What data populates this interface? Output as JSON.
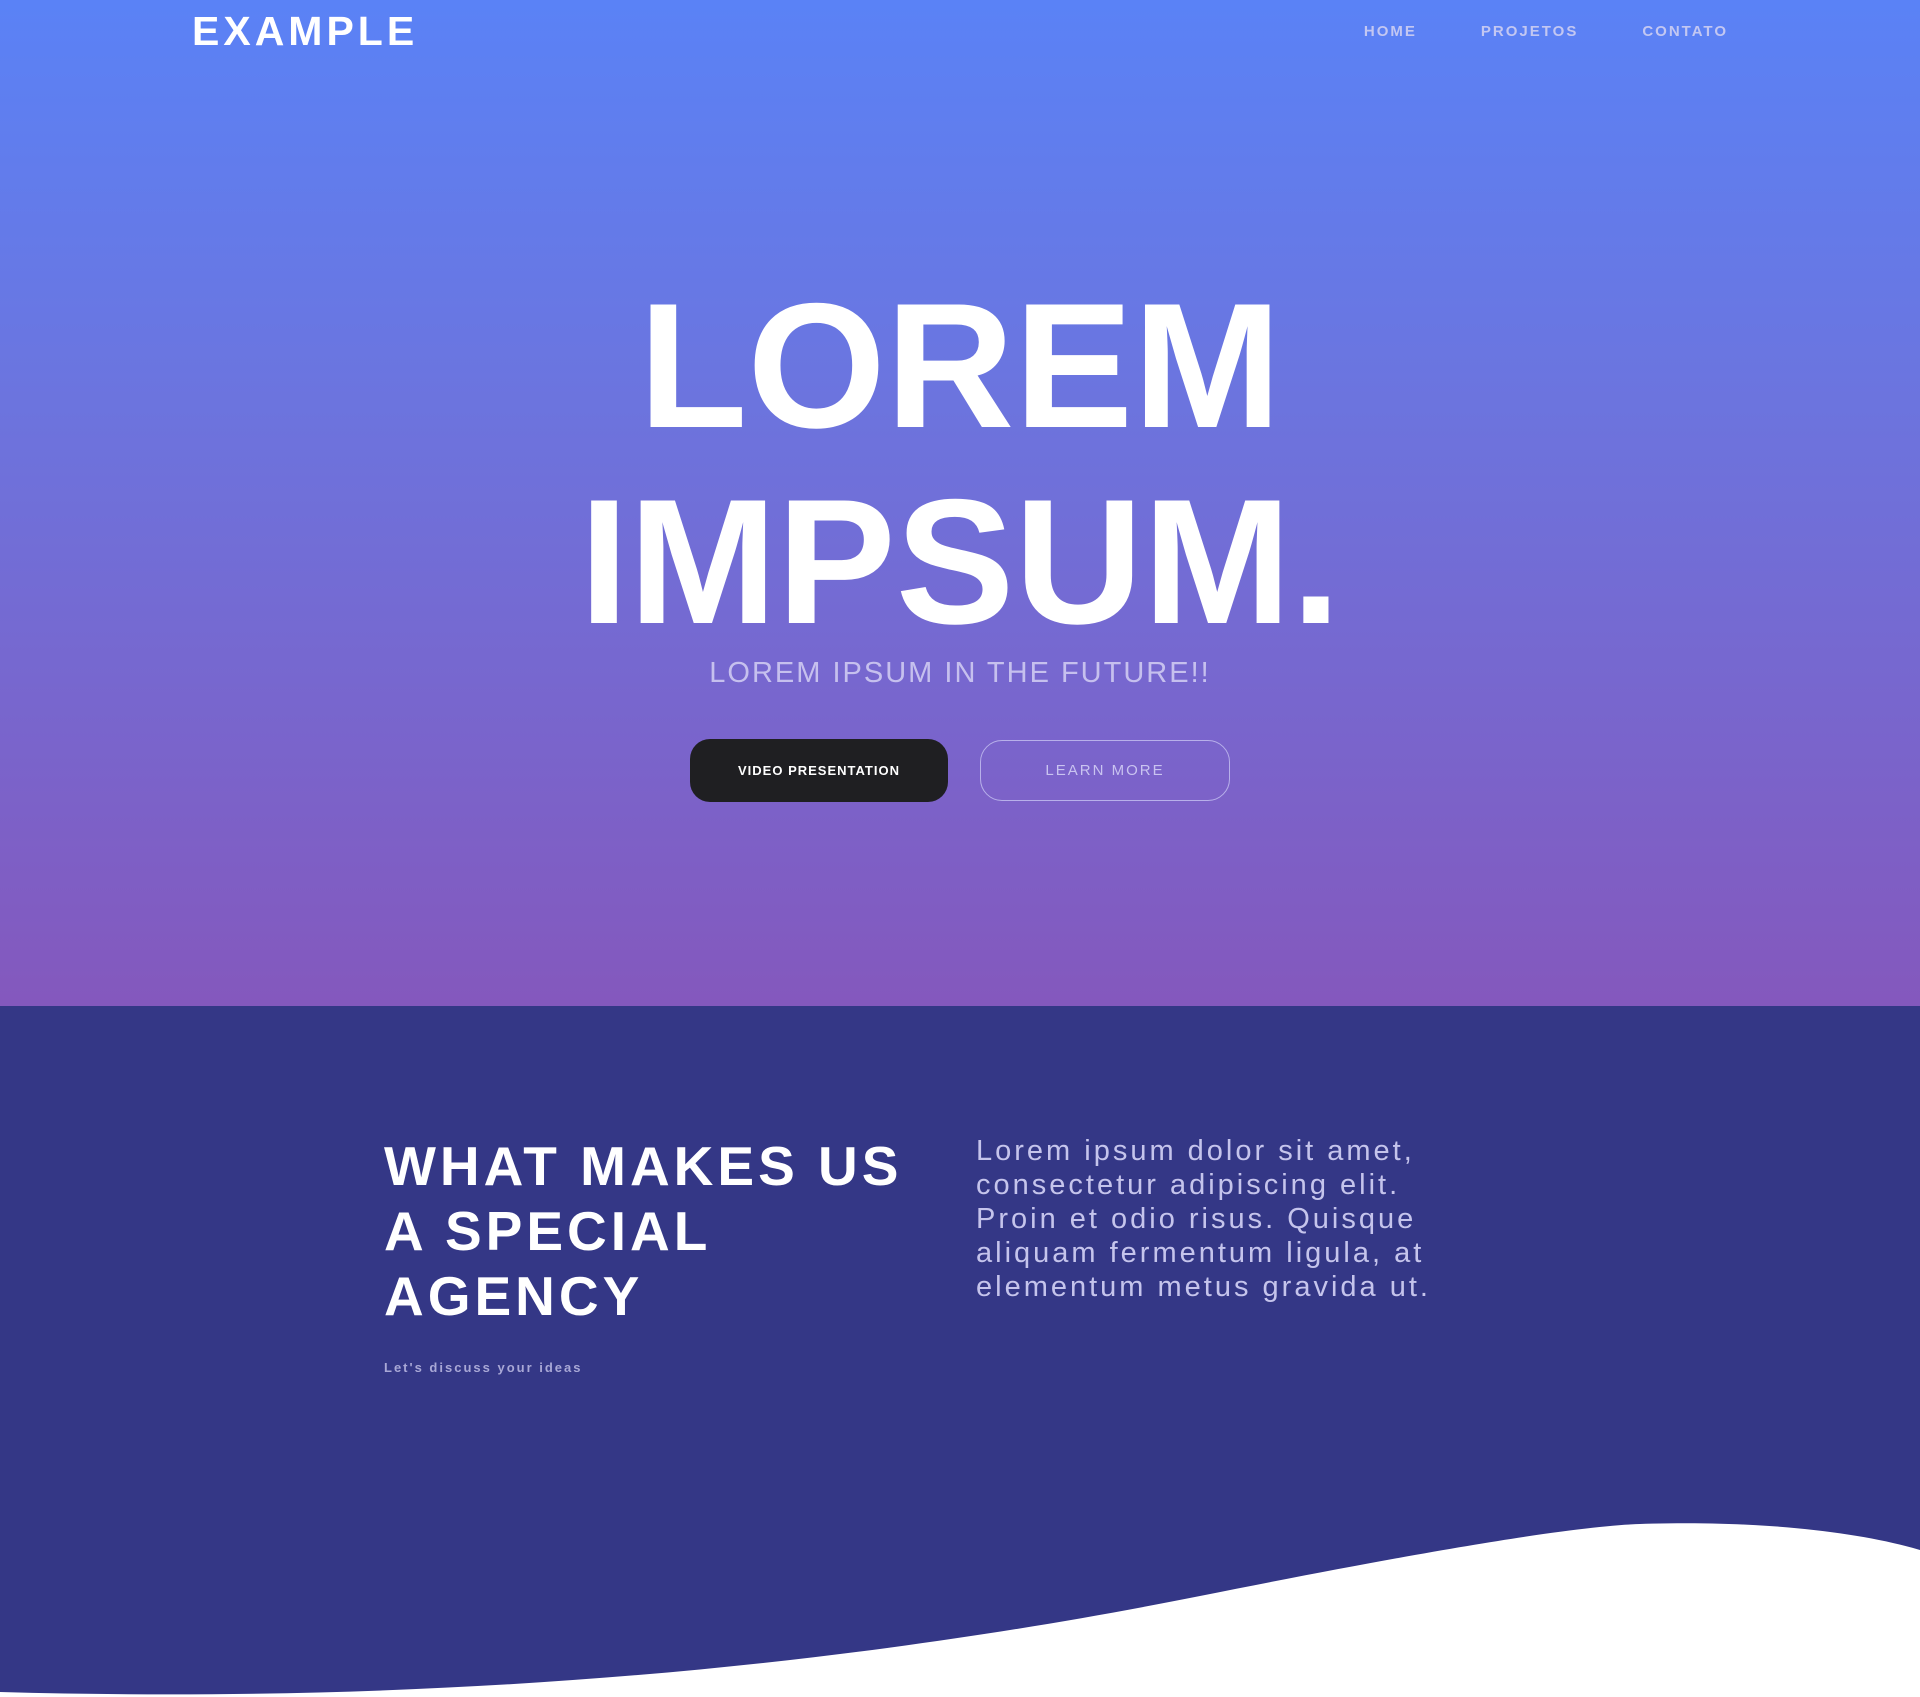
{
  "header": {
    "logo": "EXAMPLE",
    "nav": [
      "HOME",
      "PROJETOS",
      "CONTATO"
    ]
  },
  "hero": {
    "title_lines": [
      "LOREM",
      "IMPSUM."
    ],
    "subtitle": "LOREM IPSUM IN THE FUTURE!!",
    "primary_button": "VIDEO PRESENTATION",
    "secondary_button": "LEARN MORE"
  },
  "about": {
    "title_lines": [
      "WHAT MAKES US",
      "A SPECIAL",
      "AGENCY"
    ],
    "cta": "Let's discuss your ideas",
    "text_lines": [
      "Lorem ipsum dolor sit amet,",
      "consectetur adipiscing elit.",
      "Proin et odio risus. Quisque",
      "aliquam fermentum ligula, at",
      "elementum metus gravida ut."
    ]
  },
  "colors": {
    "hero_gradient_top": "#5a82f6",
    "hero_gradient_bottom": "#8458bd",
    "about_background": "#343786",
    "primary_button": "#1f1f22"
  }
}
